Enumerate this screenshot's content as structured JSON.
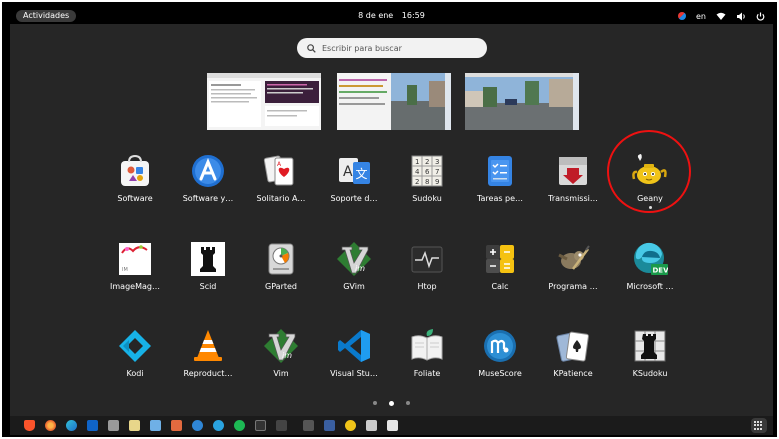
{
  "topbar": {
    "activities_label": "Actividades",
    "date": "8 de ene",
    "time": "16:59",
    "language": "en"
  },
  "search": {
    "placeholder": "Escribir para buscar"
  },
  "apps": [
    {
      "label": "Software",
      "icon": "software-icon"
    },
    {
      "label": "Software y…",
      "icon": "software-updates-icon"
    },
    {
      "label": "Solitario A…",
      "icon": "solitaire-icon"
    },
    {
      "label": "Soporte d…",
      "icon": "language-support-icon"
    },
    {
      "label": "Sudoku",
      "icon": "sudoku-icon"
    },
    {
      "label": "Tareas pe…",
      "icon": "tasks-icon"
    },
    {
      "label": "Transmissi…",
      "icon": "transmission-icon"
    },
    {
      "label": "Geany",
      "icon": "geany-icon"
    },
    {
      "label": "ImageMag…",
      "icon": "imagemagick-icon"
    },
    {
      "label": "Scid",
      "icon": "scid-icon"
    },
    {
      "label": "GParted",
      "icon": "gparted-icon"
    },
    {
      "label": "GVim",
      "icon": "gvim-icon"
    },
    {
      "label": "Htop",
      "icon": "htop-icon"
    },
    {
      "label": "Calc",
      "icon": "calc-icon"
    },
    {
      "label": "Programa …",
      "icon": "gimp-icon"
    },
    {
      "label": "Microsoft …",
      "icon": "edge-dev-icon"
    },
    {
      "label": "Kodi",
      "icon": "kodi-icon"
    },
    {
      "label": "Reproduct…",
      "icon": "vlc-icon"
    },
    {
      "label": "Vim",
      "icon": "vim-icon"
    },
    {
      "label": "Visual Stu…",
      "icon": "vscode-icon"
    },
    {
      "label": "Foliate",
      "icon": "foliate-icon"
    },
    {
      "label": "MuseScore",
      "icon": "musescore-icon"
    },
    {
      "label": "KPatience",
      "icon": "kpatience-icon"
    },
    {
      "label": "KSudoku",
      "icon": "ksudoku-icon"
    }
  ],
  "sudoku_digits": [
    "1",
    "2",
    "3",
    "4",
    "6",
    "7",
    "2",
    "8",
    "9"
  ],
  "colors": {
    "background": "#262626",
    "highlight_circle": "#ee1111",
    "search_bg": "#f2f2f2"
  },
  "dock_icons": [
    "brave-icon",
    "firefox-icon",
    "edge-icon",
    "outlook-icon",
    "files-icon",
    "app-icon",
    "document-icon",
    "store-icon",
    "browser-icon",
    "telegram-icon",
    "spotify-icon",
    "terminal-icon",
    "script-icon",
    "monitor-icon",
    "system-icon",
    "geany-icon",
    "image-icon",
    "note-icon"
  ],
  "pager": {
    "pages": 3,
    "active_page": 2
  }
}
